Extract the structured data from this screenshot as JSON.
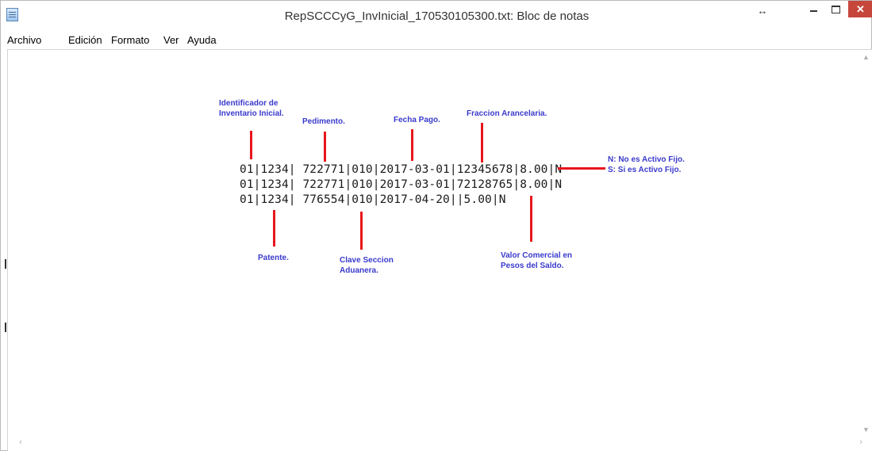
{
  "window": {
    "title": "RepSCCCyG_InvInicial_170530105300.txt: Bloc de notas",
    "resize_glyph": "↔",
    "close_glyph": "✕"
  },
  "menu": {
    "items": [
      "Archivo",
      "Edición",
      "Formato",
      "Ver",
      "Ayuda"
    ]
  },
  "document": {
    "lines": [
      "01|1234| 722771|010|2017-03-01|12345678|8.00|N",
      "01|1234| 722771|010|2017-03-01|72128765|8.00|N",
      "01|1234| 776554|010|2017-04-20||5.00|N"
    ]
  },
  "annotations": {
    "identificador": [
      "Identificador de",
      "Inventario Inicial."
    ],
    "pedimento": "Pedimento.",
    "fecha": "Fecha Pago.",
    "fraccion": "Fraccion Arancelaria.",
    "activo": [
      "N: No es Activo Fijo.",
      "S: Si es Activo Fijo."
    ],
    "patente": "Patente.",
    "clave": [
      "Clave Seccion",
      "Aduanera."
    ],
    "valor": [
      "Valor Comercial en",
      "Pesos del Saldo."
    ]
  },
  "colors": {
    "annotation_text": "#3a3acc",
    "annotation_line": "#e8161c",
    "close_button": "#c7463c"
  },
  "icons": {
    "app": "notepad-icon",
    "scroll_up": "chevron-up-icon",
    "scroll_down": "chevron-down-icon",
    "scroll_left": "chevron-left-icon",
    "scroll_right": "chevron-right-icon"
  }
}
